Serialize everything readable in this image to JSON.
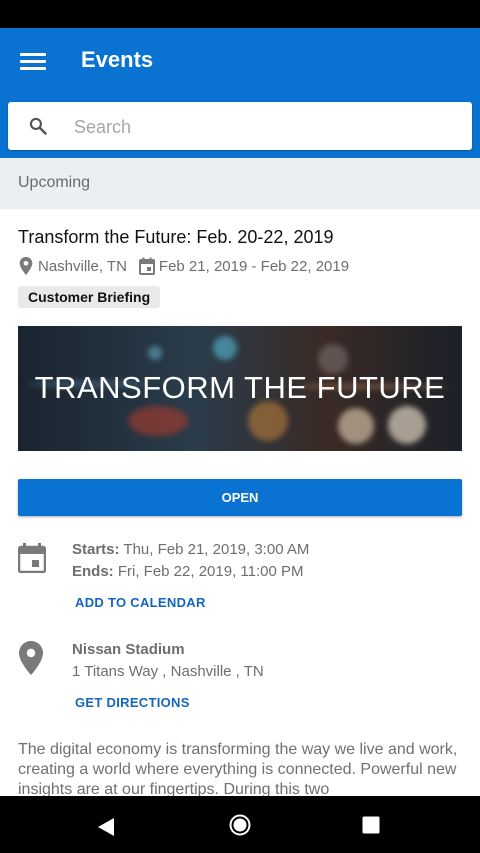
{
  "app_bar": {
    "title": "Events",
    "menu_icon": "hamburger-menu-icon",
    "color": "#0a73d1"
  },
  "search": {
    "placeholder": "Search",
    "value": "",
    "icon": "search-icon"
  },
  "section": {
    "label": "Upcoming"
  },
  "event": {
    "title": "Transform the Future: Feb. 20-22, 2019",
    "location": "Nashville, TN",
    "date_range": "Feb 21, 2019 - Feb 22, 2019",
    "tag": "Customer Briefing",
    "banner_text": "TRANSFORM THE FUTURE",
    "open_label": "OPEN",
    "starts_label": "Starts:",
    "starts_value": "Thu, Feb 21, 2019, 3:00 AM",
    "ends_label": "Ends:",
    "ends_value": "Fri, Feb 22, 2019, 11:00 PM",
    "add_to_calendar": "ADD TO CALENDAR",
    "venue_name": "Nissan Stadium",
    "venue_address": "1 Titans Way , Nashville , TN",
    "get_directions": "GET DIRECTIONS",
    "description": "The digital economy is transforming the way we live and work, creating a world where everything is connected. Powerful new insights are at our fingertips. During this two"
  },
  "nav": {
    "back_icon": "back-icon",
    "home_icon": "home-icon",
    "recents_icon": "recents-icon"
  }
}
